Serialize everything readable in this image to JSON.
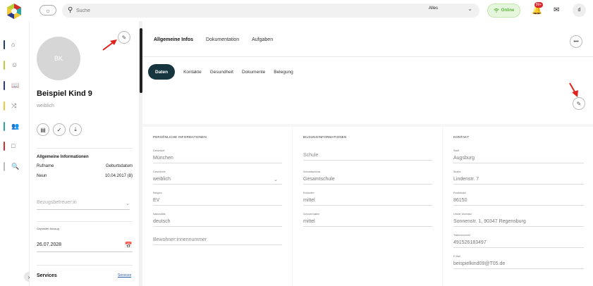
{
  "topbar": {
    "search_placeholder": "Suche",
    "search_scope": "Alles",
    "online_label": "Online",
    "notification_count": "99+",
    "user_initial": "d"
  },
  "leftnav": {
    "items": [
      {
        "icon": "home-icon",
        "color": "#1d3a6b"
      },
      {
        "icon": "smiley-icon",
        "color": "#b8cf3a"
      },
      {
        "icon": "book-icon",
        "color": "#2b3a8a"
      },
      {
        "icon": "shuffle-icon",
        "color": "#f2c73b"
      },
      {
        "icon": "group-icon",
        "color": "#2aa6a6"
      },
      {
        "icon": "building-icon",
        "color": "#d0302c"
      },
      {
        "icon": "search-file-icon",
        "color": "#bbbbbb"
      }
    ]
  },
  "profile": {
    "initials": "BK",
    "name": "Beispiel Kind 9",
    "gender": "weiblich",
    "info_title": "Allgemeine Informationen",
    "info_rows": [
      {
        "left": "Rufname",
        "right": "Geburtsdatum"
      },
      {
        "left": "Neun",
        "right": "10.04.2017 (8)"
      }
    ],
    "caretaker_placeholder": "Bezugsbetreuer:in",
    "date_label": "Geplanter Auszug",
    "date_value": "26.07.2028",
    "services_title": "Services",
    "services_link": "Services"
  },
  "main": {
    "tabs": [
      {
        "label": "Allgemeine Infos",
        "active": true
      },
      {
        "label": "Dokumentation",
        "active": false
      },
      {
        "label": "Aufgaben",
        "active": false
      }
    ],
    "subtabs": [
      {
        "label": "Daten",
        "active": true
      },
      {
        "label": "Kontakte",
        "active": false
      },
      {
        "label": "Gesundheit",
        "active": false
      },
      {
        "label": "Dokumente",
        "active": false
      },
      {
        "label": "Belegung",
        "active": false
      }
    ],
    "columns": [
      {
        "title": "PERSÖNLICHE INFORMATIONEN",
        "fields": [
          {
            "label": "Geburtsort",
            "value": "München"
          },
          {
            "label": "Geschlecht",
            "value": "weiblich",
            "dropdown": true
          },
          {
            "label": "Religion",
            "value": "EV"
          },
          {
            "label": "Nationalität",
            "value": "deutsch"
          },
          {
            "label": "",
            "value": "Bewohner:innennummer"
          }
        ]
      },
      {
        "title": "BILDUNGINFORMATIONEN",
        "fields": [
          {
            "label": "",
            "value": "Schule"
          },
          {
            "label": "Schulabschluss",
            "value": "Gesamtschule"
          },
          {
            "label": "Einkaufen",
            "value": "mittel"
          },
          {
            "label": "Schulverhalten",
            "value": "mittel"
          }
        ]
      },
      {
        "title": "KONTAKT",
        "fields": [
          {
            "label": "Stadt",
            "value": "Augsburg"
          },
          {
            "label": "Straße",
            "value": "Lindenstr. 7"
          },
          {
            "label": "Postleitzahl",
            "value": "86150"
          },
          {
            "label": "Letzter Wohnsitz",
            "value": "Sonnenstr. 1, 90347 Regensburg"
          },
          {
            "label": "Telefonnummer",
            "value": "491526183497"
          },
          {
            "label": "E-Mail",
            "value": "beispielkind09@T05.de"
          }
        ]
      }
    ]
  }
}
